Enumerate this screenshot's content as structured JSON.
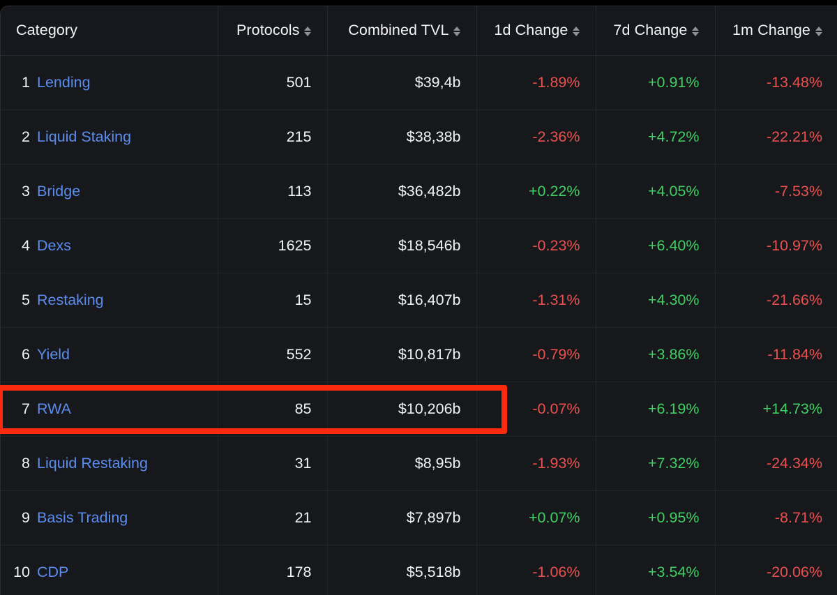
{
  "table": {
    "columns": [
      {
        "key": "category",
        "label": "Category",
        "align": "left",
        "sortable": false
      },
      {
        "key": "protocols",
        "label": "Protocols",
        "align": "right",
        "sortable": true
      },
      {
        "key": "tvl",
        "label": "Combined TVL",
        "align": "right",
        "sortable": true
      },
      {
        "key": "d1",
        "label": "1d Change",
        "align": "right",
        "sortable": true
      },
      {
        "key": "d7",
        "label": "7d Change",
        "align": "right",
        "sortable": true
      },
      {
        "key": "m1",
        "label": "1m Change",
        "align": "right",
        "sortable": true
      }
    ],
    "sort_icon_name": "sort-arrows-icon",
    "rows": [
      {
        "rank": "1",
        "category": "Lending",
        "protocols": "501",
        "tvl": "$39,4b",
        "d1": "-1.89%",
        "d1_dir": "neg",
        "d7": "+0.91%",
        "d7_dir": "pos",
        "m1": "-13.48%",
        "m1_dir": "neg"
      },
      {
        "rank": "2",
        "category": "Liquid Staking",
        "protocols": "215",
        "tvl": "$38,38b",
        "d1": "-2.36%",
        "d1_dir": "neg",
        "d7": "+4.72%",
        "d7_dir": "pos",
        "m1": "-22.21%",
        "m1_dir": "neg"
      },
      {
        "rank": "3",
        "category": "Bridge",
        "protocols": "113",
        "tvl": "$36,482b",
        "d1": "+0.22%",
        "d1_dir": "pos",
        "d7": "+4.05%",
        "d7_dir": "pos",
        "m1": "-7.53%",
        "m1_dir": "neg"
      },
      {
        "rank": "4",
        "category": "Dexs",
        "protocols": "1625",
        "tvl": "$18,546b",
        "d1": "-0.23%",
        "d1_dir": "neg",
        "d7": "+6.40%",
        "d7_dir": "pos",
        "m1": "-10.97%",
        "m1_dir": "neg"
      },
      {
        "rank": "5",
        "category": "Restaking",
        "protocols": "15",
        "tvl": "$16,407b",
        "d1": "-1.31%",
        "d1_dir": "neg",
        "d7": "+4.30%",
        "d7_dir": "pos",
        "m1": "-21.66%",
        "m1_dir": "neg"
      },
      {
        "rank": "6",
        "category": "Yield",
        "protocols": "552",
        "tvl": "$10,817b",
        "d1": "-0.79%",
        "d1_dir": "neg",
        "d7": "+3.86%",
        "d7_dir": "pos",
        "m1": "-11.84%",
        "m1_dir": "neg"
      },
      {
        "rank": "7",
        "category": "RWA",
        "protocols": "85",
        "tvl": "$10,206b",
        "d1": "-0.07%",
        "d1_dir": "neg",
        "d7": "+6.19%",
        "d7_dir": "pos",
        "m1": "+14.73%",
        "m1_dir": "pos"
      },
      {
        "rank": "8",
        "category": "Liquid Restaking",
        "protocols": "31",
        "tvl": "$8,95b",
        "d1": "-1.93%",
        "d1_dir": "neg",
        "d7": "+7.32%",
        "d7_dir": "pos",
        "m1": "-24.34%",
        "m1_dir": "neg"
      },
      {
        "rank": "9",
        "category": "Basis Trading",
        "protocols": "21",
        "tvl": "$7,897b",
        "d1": "+0.07%",
        "d1_dir": "pos",
        "d7": "+0.95%",
        "d7_dir": "pos",
        "m1": "-8.71%",
        "m1_dir": "neg"
      },
      {
        "rank": "10",
        "category": "CDP",
        "protocols": "178",
        "tvl": "$5,518b",
        "d1": "-1.06%",
        "d1_dir": "neg",
        "d7": "+3.54%",
        "d7_dir": "pos",
        "m1": "-20.06%",
        "m1_dir": "neg"
      }
    ]
  },
  "annotation": {
    "name": "highlight-box-row-rwa",
    "target_rank": "7",
    "color": "#fa2a0e"
  },
  "colors": {
    "background": "#17181c",
    "link": "#5b8def",
    "positive": "#3fcf62",
    "negative": "#e8514f",
    "text": "#f2f3f5",
    "divider": "#222429"
  }
}
